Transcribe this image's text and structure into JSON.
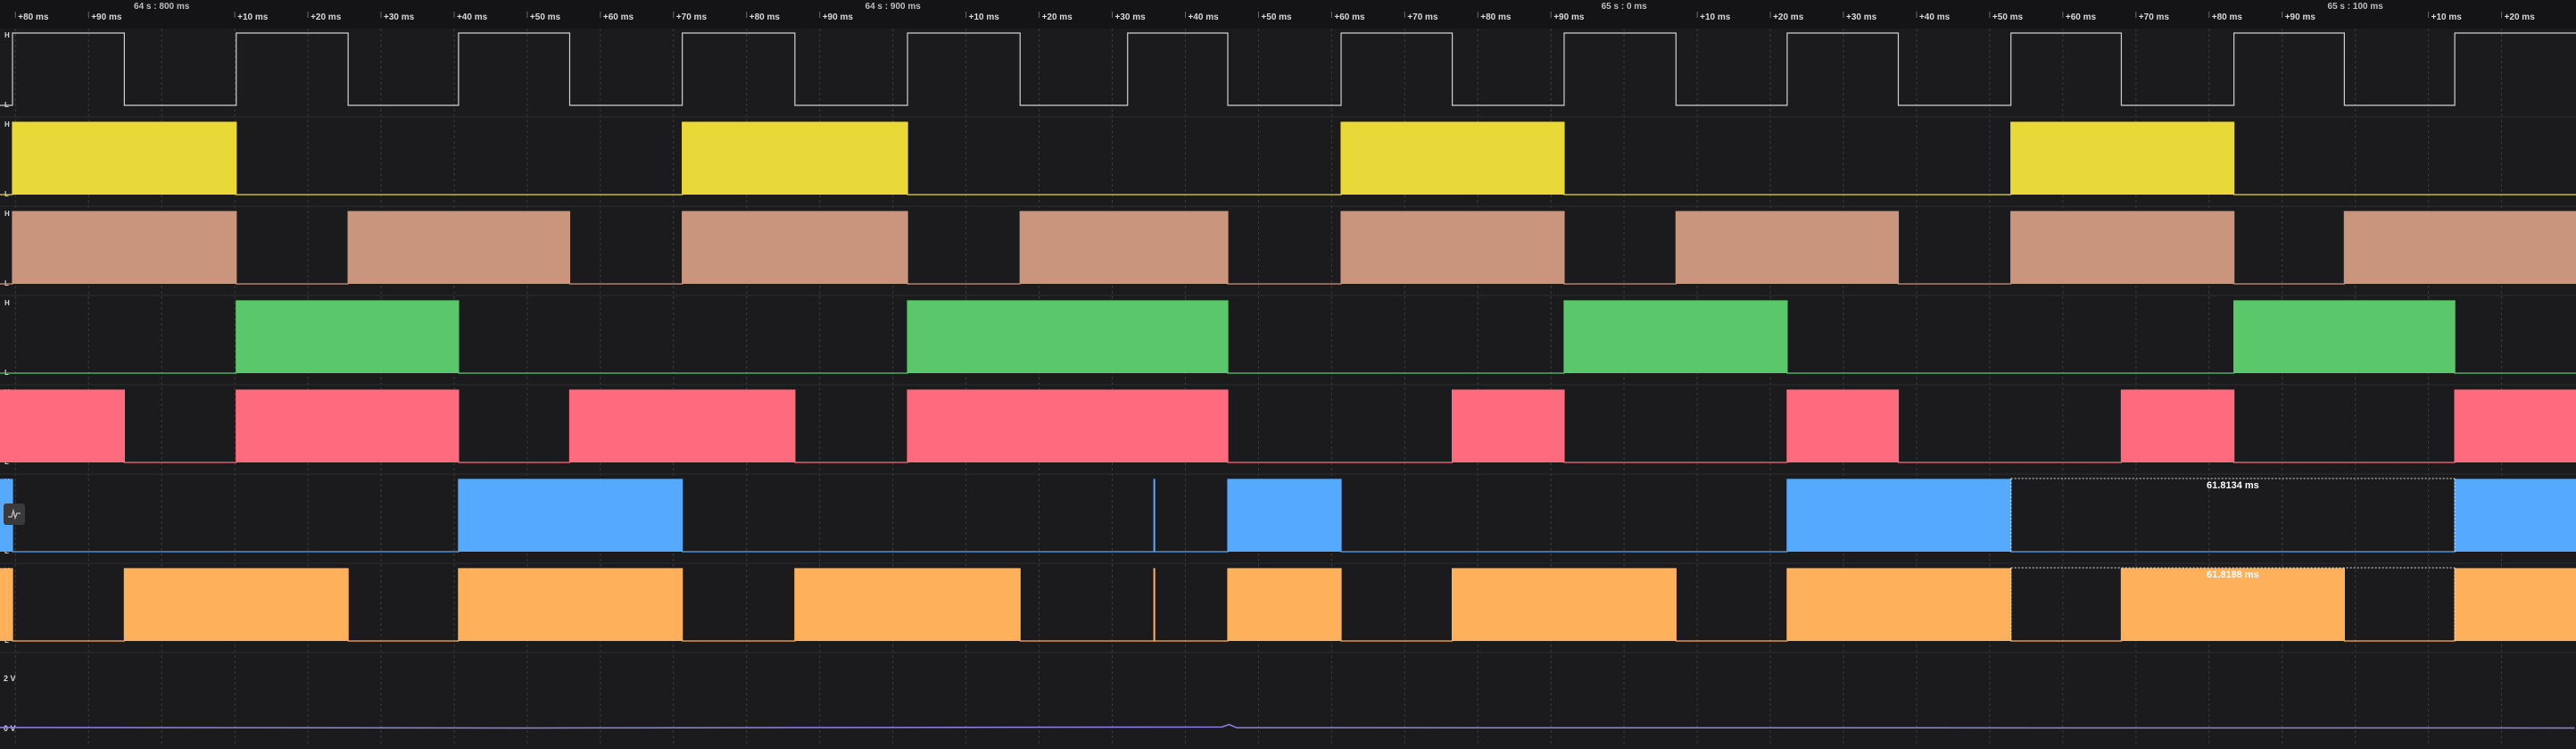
{
  "timeline": {
    "anchors": [
      {
        "label": "64 s : 800 ms",
        "ms": 800
      },
      {
        "label": "64 s : 900 ms",
        "ms": 900
      },
      {
        "label": "65 s : 0 ms",
        "ms": 1000
      },
      {
        "label": "65 s : 100 ms",
        "ms": 1100
      }
    ],
    "ticks": [
      {
        "label": "+80 ms",
        "ms": 780
      },
      {
        "label": "+90 ms",
        "ms": 790
      },
      {
        "label": "+10 ms",
        "ms": 810
      },
      {
        "label": "+20 ms",
        "ms": 820
      },
      {
        "label": "+30 ms",
        "ms": 830
      },
      {
        "label": "+40 ms",
        "ms": 840
      },
      {
        "label": "+50 ms",
        "ms": 850
      },
      {
        "label": "+60 ms",
        "ms": 860
      },
      {
        "label": "+70 ms",
        "ms": 870
      },
      {
        "label": "+80 ms",
        "ms": 880
      },
      {
        "label": "+90 ms",
        "ms": 890
      },
      {
        "label": "+10 ms",
        "ms": 910
      },
      {
        "label": "+20 ms",
        "ms": 920
      },
      {
        "label": "+30 ms",
        "ms": 930
      },
      {
        "label": "+40 ms",
        "ms": 940
      },
      {
        "label": "+50 ms",
        "ms": 950
      },
      {
        "label": "+60 ms",
        "ms": 960
      },
      {
        "label": "+70 ms",
        "ms": 970
      },
      {
        "label": "+80 ms",
        "ms": 980
      },
      {
        "label": "+90 ms",
        "ms": 990
      },
      {
        "label": "+10 ms",
        "ms": 1010
      },
      {
        "label": "+20 ms",
        "ms": 1020
      },
      {
        "label": "+30 ms",
        "ms": 1030
      },
      {
        "label": "+40 ms",
        "ms": 1040
      },
      {
        "label": "+50 ms",
        "ms": 1050
      },
      {
        "label": "+60 ms",
        "ms": 1060
      },
      {
        "label": "+70 ms",
        "ms": 1070
      },
      {
        "label": "+80 ms",
        "ms": 1080
      },
      {
        "label": "+90 ms",
        "ms": 1090
      },
      {
        "label": "+10 ms",
        "ms": 1110
      },
      {
        "label": "+20 ms",
        "ms": 1120
      }
    ]
  },
  "level_labels": {
    "high": "H",
    "low": "L"
  },
  "channels": [
    {
      "color": "#cfcfcf",
      "style": "line",
      "start_level": 0,
      "toggles": [
        779.6,
        794.9,
        810.2,
        825.5,
        840.6,
        855.8,
        871.2,
        886.6,
        902.0,
        917.4,
        932.1,
        945.8,
        961.3,
        976.5,
        991.8,
        1007.1,
        1022.3,
        1037.5,
        1052.9,
        1068.0,
        1083.4,
        1098.5,
        1113.6
      ]
    },
    {
      "color": "#e8d838",
      "style": "fill",
      "start_level": 0,
      "toggles": [
        779.6,
        810.2,
        871.2,
        902.0,
        961.3,
        991.8,
        1052.9,
        1083.4
      ]
    },
    {
      "color": "#c9957c",
      "style": "fill",
      "start_level": 0,
      "toggles": [
        779.6,
        810.2,
        825.5,
        855.8,
        871.2,
        902.0,
        917.4,
        945.8,
        961.3,
        991.8,
        1007.1,
        1037.5,
        1052.9,
        1083.4,
        1098.5
      ]
    },
    {
      "color": "#5ac86a",
      "style": "fill",
      "start_level": 0,
      "toggles": [
        810.2,
        840.6,
        902.0,
        945.8,
        991.8,
        1022.3,
        1083.4,
        1113.6
      ]
    },
    {
      "color": "#ff6b7e",
      "style": "fill",
      "start_level": 1,
      "toggles": [
        794.9,
        810.2,
        840.6,
        855.8,
        886.6,
        902.0,
        945.8,
        976.5,
        991.8,
        1022.3,
        1037.5,
        1068.0,
        1083.4,
        1113.6
      ]
    },
    {
      "color": "#55aaff",
      "style": "fill",
      "start_level": 1,
      "toggles": [
        779.6,
        840.6,
        871.2,
        935.7,
        935.8,
        945.8,
        961.3,
        1022.3,
        1052.9,
        1113.6
      ]
    },
    {
      "color": "#ffb05a",
      "style": "fill",
      "start_level": 1,
      "toggles": [
        779.6,
        794.9,
        825.5,
        840.6,
        871.2,
        886.6,
        917.4,
        935.7,
        935.8,
        945.8,
        961.3,
        976.5,
        1007.1,
        1022.3,
        1052.9,
        1068.0,
        1098.5,
        1113.6
      ]
    }
  ],
  "analog": {
    "color": "#8b85e8",
    "labels": [
      {
        "text": "2 V",
        "v": 2
      },
      {
        "text": "0 V",
        "v": 0
      }
    ],
    "points": [
      [
        775,
        0.04
      ],
      [
        850,
        0.02
      ],
      [
        945,
        0.06
      ],
      [
        946,
        0.16
      ],
      [
        947,
        0.03
      ],
      [
        1130,
        0.02
      ]
    ]
  },
  "measurements": [
    {
      "label": "61.8134 ms",
      "channel": 5,
      "start_ms": 1052.9,
      "end_ms": 1113.6
    },
    {
      "label": "61.8188 ms",
      "channel": 6,
      "start_ms": 1052.9,
      "end_ms": 1113.6
    }
  ],
  "colors": {
    "grid": "#3b3b3f",
    "separator": "#2c2c2f",
    "label": "#d8d8d8"
  }
}
